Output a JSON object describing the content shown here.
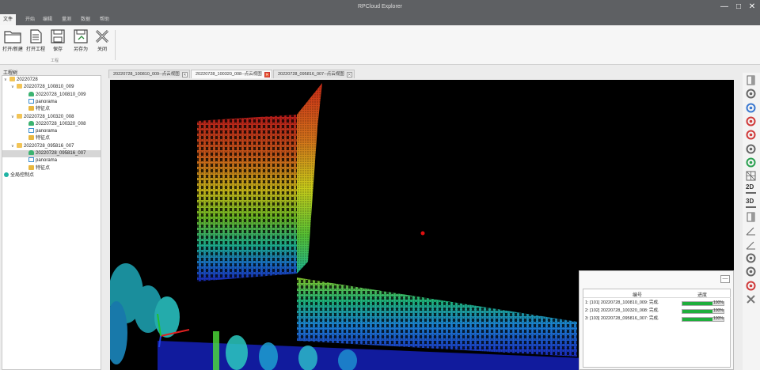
{
  "window": {
    "title": "RPCloud Explorer",
    "controls": {
      "minimize": "—",
      "maximize": "□",
      "close": "✕"
    }
  },
  "menu": [
    {
      "label": "文件",
      "active": true
    },
    {
      "label": "开始"
    },
    {
      "label": "编辑"
    },
    {
      "label": "量测"
    },
    {
      "label": "数据"
    },
    {
      "label": "帮助"
    }
  ],
  "ribbon": {
    "buttons": [
      {
        "label": "打开/新建",
        "icon": "folder-icon"
      },
      {
        "label": "打开工程",
        "icon": "document-icon"
      },
      {
        "label": "保存",
        "icon": "save-icon"
      },
      {
        "label": "另存为",
        "icon": "save-as-icon"
      },
      {
        "label": "关闭",
        "icon": "close-tool-icon"
      }
    ],
    "group_label": "工程"
  },
  "project_tree": {
    "title": "工程树",
    "nodes": [
      {
        "label": "20220728",
        "type": "folder",
        "level": 0,
        "expanded": true
      },
      {
        "label": "20220728_100810_009",
        "type": "folder",
        "level": 1,
        "expanded": true
      },
      {
        "label": "20220728_100810_009",
        "type": "cloud",
        "level": 2
      },
      {
        "label": "panorama",
        "type": "pano",
        "level": 2
      },
      {
        "label": "特征点",
        "type": "feat",
        "level": 2
      },
      {
        "label": "20220728_100320_008",
        "type": "folder",
        "level": 1,
        "expanded": true
      },
      {
        "label": "20220728_100320_008",
        "type": "cloud",
        "level": 2
      },
      {
        "label": "panorama",
        "type": "pano",
        "level": 2
      },
      {
        "label": "特征点",
        "type": "feat",
        "level": 2
      },
      {
        "label": "20220728_095816_007",
        "type": "folder",
        "level": 1,
        "expanded": true
      },
      {
        "label": "20220728_095816_007",
        "type": "cloud",
        "level": 2,
        "selected": true
      },
      {
        "label": "panorama",
        "type": "pano",
        "level": 2
      },
      {
        "label": "特征点",
        "type": "feat",
        "level": 2
      },
      {
        "label": "全局控制点",
        "type": "globe",
        "level": 0
      }
    ]
  },
  "tabs": [
    {
      "label": "20220728_100810_009--点云视图",
      "active": false
    },
    {
      "label": "20220728_100320_008--点云视图",
      "active": true
    },
    {
      "label": "20220728_095816_007--点云视图",
      "active": false
    }
  ],
  "right_toolbar": {
    "tools": [
      "panel-icon",
      "orbit-icon",
      "rgb-color-icon",
      "multi-color-icon",
      "intensity-icon",
      "elevation-icon",
      "classification-icon",
      "grid-icon",
      "2d-view-icon",
      "3d-view-icon",
      "section-icon",
      "slope-icon",
      "angle-icon",
      "distance-icon",
      "area-icon",
      "clear-measure-icon",
      "delete-icon"
    ],
    "labels": {
      "2d": "2D",
      "3d": "3D"
    }
  },
  "progress": {
    "minimize": "—",
    "headers": {
      "id": "编号",
      "progress": "进度"
    },
    "rows": [
      {
        "text": "1: [101] 20220728_100810_009: 完成.",
        "percent": 100,
        "percent_label": "100%"
      },
      {
        "text": "2: [102] 20220728_100320_008: 完成.",
        "percent": 100,
        "percent_label": "100%"
      },
      {
        "text": "3: [103] 20220728_095816_007: 完成.",
        "percent": 100,
        "percent_label": "100%"
      }
    ]
  },
  "colors": {
    "titlebar": "#5e6063",
    "progress_fill": "#1fae3c",
    "active_tab_close": "#e8572c",
    "viewport_bg": "#000000"
  }
}
